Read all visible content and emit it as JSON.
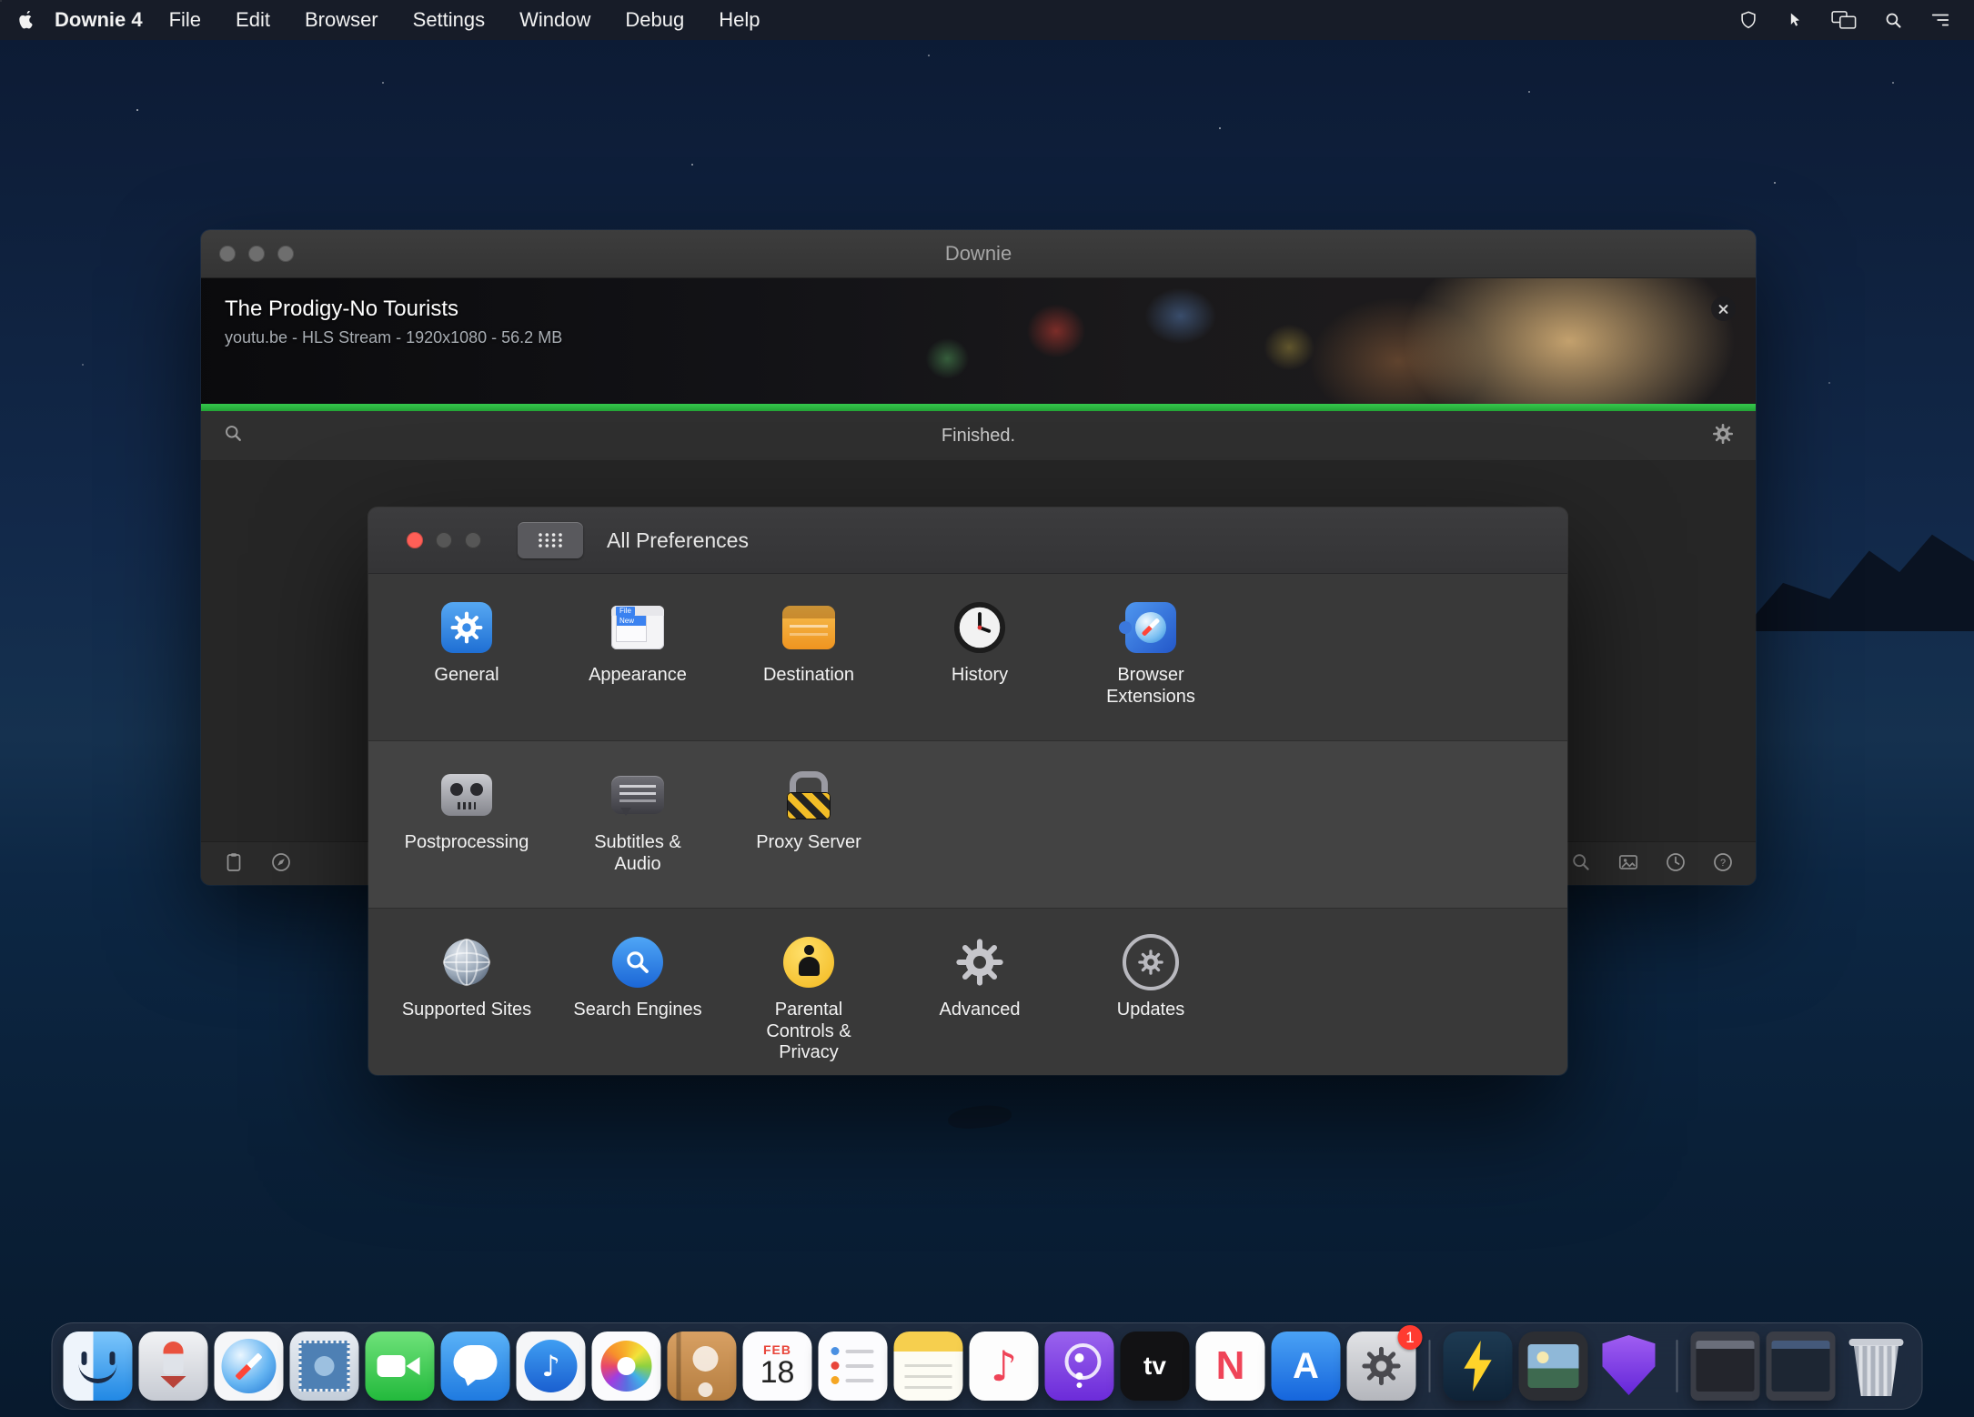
{
  "colors": {
    "accent_blue": "#2f7cf6",
    "progress_green": "#2cb440",
    "traffic_close_red": "#ff5f57",
    "badge_red": "#ff3b30"
  },
  "menu_bar": {
    "app_name": "Downie 4",
    "menus": [
      "File",
      "Edit",
      "Browser",
      "Settings",
      "Window",
      "Debug",
      "Help"
    ],
    "status_icons": [
      "shield-icon",
      "cursor-icon",
      "displays-icon",
      "spotlight-search-icon",
      "notification-list-icon"
    ]
  },
  "downie_window": {
    "title": "Downie",
    "download_item": {
      "title": "The Prodigy-No Tourists",
      "subtitle": "youtu.be - HLS Stream - 1920x1080 - 56.2 MB",
      "status": "Finished.",
      "progress_percent": 100,
      "progress_style": "width:100%"
    },
    "toolbar": {
      "left_icons": [
        "clipboard-icon",
        "compass-icon"
      ],
      "right_icons": [
        "search-icon",
        "image-icon",
        "history-clock-icon",
        "help-icon"
      ],
      "help_glyph": "?"
    }
  },
  "preferences_window": {
    "title": "All Preferences",
    "appearance_icon": {
      "menu": "File",
      "item": "New"
    },
    "rows": [
      {
        "items": [
          {
            "label": "General",
            "icon": "general-gear-icon"
          },
          {
            "label": "Appearance",
            "icon": "appearance-window-icon"
          },
          {
            "label": "Destination",
            "icon": "destination-drive-icon"
          },
          {
            "label": "History",
            "icon": "history-clock-icon"
          },
          {
            "label": "Browser Extensions",
            "icon": "browser-extensions-puzzle-icon"
          }
        ]
      },
      {
        "items": [
          {
            "label": "Postprocessing",
            "icon": "postprocessing-robot-icon"
          },
          {
            "label": "Subtitles & Audio",
            "icon": "subtitles-bubble-icon"
          },
          {
            "label": "Proxy Server",
            "icon": "proxy-lock-icon"
          }
        ]
      },
      {
        "items": [
          {
            "label": "Supported Sites",
            "icon": "supported-sites-globe-icon"
          },
          {
            "label": "Search Engines",
            "icon": "search-engines-magnifier-icon"
          },
          {
            "label": "Parental Controls & Privacy",
            "icon": "parental-controls-figure-icon"
          },
          {
            "label": "Advanced",
            "icon": "advanced-gear-icon"
          },
          {
            "label": "Updates",
            "icon": "updates-gear-circle-icon"
          }
        ]
      }
    ]
  },
  "dock": {
    "items": [
      "finder",
      "rocket",
      "safari",
      "stamp",
      "facetime",
      "messages",
      "music-circle",
      "photos",
      "contacts",
      "calendar",
      "reminders",
      "notes",
      "music",
      "podcasts",
      "apple-tv",
      "news",
      "app-store",
      "system-preferences",
      "bolt",
      "pictures",
      "shield",
      "minimized-window-1",
      "minimized-window-2",
      "trash"
    ],
    "calendar": {
      "month": "FEB",
      "day": "18"
    },
    "system_preferences_badge": "1",
    "apple_tv_label": "tv",
    "news_label": "N",
    "app_store_label": "A"
  }
}
